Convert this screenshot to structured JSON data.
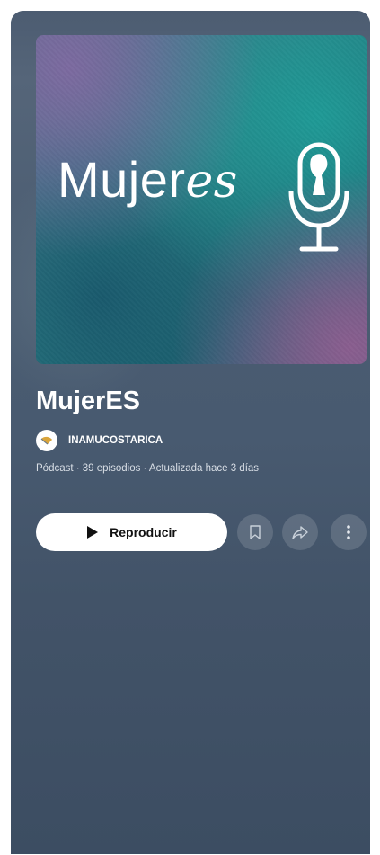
{
  "podcast": {
    "title": "MujerES",
    "cover_text_main": "Mujer",
    "cover_text_script": "es",
    "author": "INAMUCOSTARICA",
    "meta": "Pódcast · 39 episodios · Actualizada hace 3 días"
  },
  "actions": {
    "play_label": "Reproducir",
    "save_icon": "bookmark-icon",
    "share_icon": "share-icon",
    "more_icon": "more-vertical-icon"
  },
  "colors": {
    "panel_bg": "#4b5d72",
    "play_button_bg": "#ffffff",
    "text_primary": "#ffffff",
    "text_secondary": "#d9dfe6"
  }
}
